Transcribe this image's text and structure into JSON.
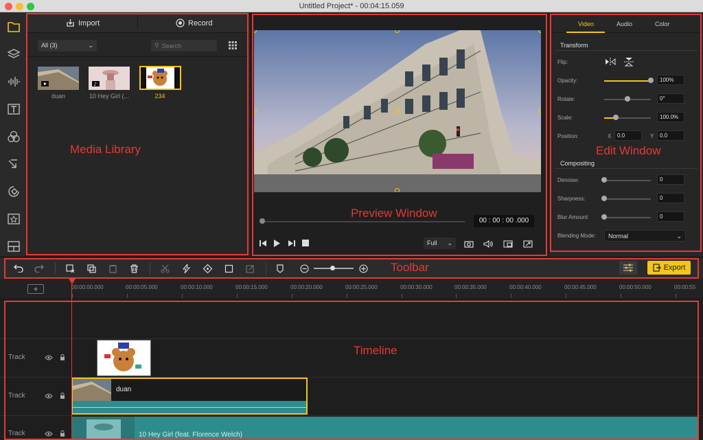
{
  "window": {
    "title": "Untitled Project* - 00:04:15.059"
  },
  "sidebar": {
    "items": [
      "folder-icon",
      "layers-icon",
      "audio-wave-icon",
      "text-icon",
      "filter-icon",
      "transition-icon",
      "overlay-icon",
      "sticker-icon",
      "layout-icon"
    ]
  },
  "media_library": {
    "import_label": "Import",
    "record_label": "Record",
    "filter_value": "All (3)",
    "search_placeholder": "Search",
    "items": [
      {
        "label": "duan"
      },
      {
        "label": "10 Hey Girl (..."
      },
      {
        "label": "234"
      }
    ],
    "annotation": "Media Library"
  },
  "preview": {
    "timecode": "00 : 00 : 00 .000",
    "zoom": "Full",
    "annotation": "Preview Window"
  },
  "edit": {
    "tabs": [
      "Video",
      "Audio",
      "Color"
    ],
    "active_tab": "Video",
    "transform_title": "Transform",
    "flip_label": "Flip:",
    "opacity_label": "Opacity:",
    "opacity_value": "100%",
    "rotate_label": "Rotate:",
    "rotate_value": "0°",
    "scale_label": "Scale:",
    "scale_value": "100.0%",
    "position_label": "Position:",
    "pos_x_label": "X",
    "pos_x_value": "0.0",
    "pos_y_label": "Y",
    "pos_y_value": "0.0",
    "compositing_title": "Compositing",
    "denoise_label": "Denoise:",
    "denoise_value": "0",
    "sharpness_label": "Sharpness:",
    "sharpness_value": "0",
    "blur_label": "Blur Amount:",
    "blur_value": "0",
    "blend_label": "Blending Mode:",
    "blend_value": "Normal",
    "annotation": "Edit Window"
  },
  "toolbar": {
    "export_label": "Export",
    "annotation": "Toolbar"
  },
  "timeline": {
    "ticks": [
      "00:00:00.000",
      "00:00:05.000",
      "00:00:10.000",
      "00:00:15.000",
      "00:00:20.000",
      "00:00:25.000",
      "00:00:30.000",
      "00:00:35.000",
      "00:00:40.000",
      "00:00:45.000",
      "00:00:50.000",
      "00:00:55"
    ],
    "tracks": [
      "Track",
      "Track",
      "Track"
    ],
    "clip_video_label": "duan",
    "clip_audio_label": "10 Hey Girl (feat. Florence Welch)",
    "annotation": "Timeline"
  },
  "colors": {
    "accent": "#f5c518",
    "annotation_red": "#e53935",
    "clip_teal": "#2e8c8c"
  }
}
